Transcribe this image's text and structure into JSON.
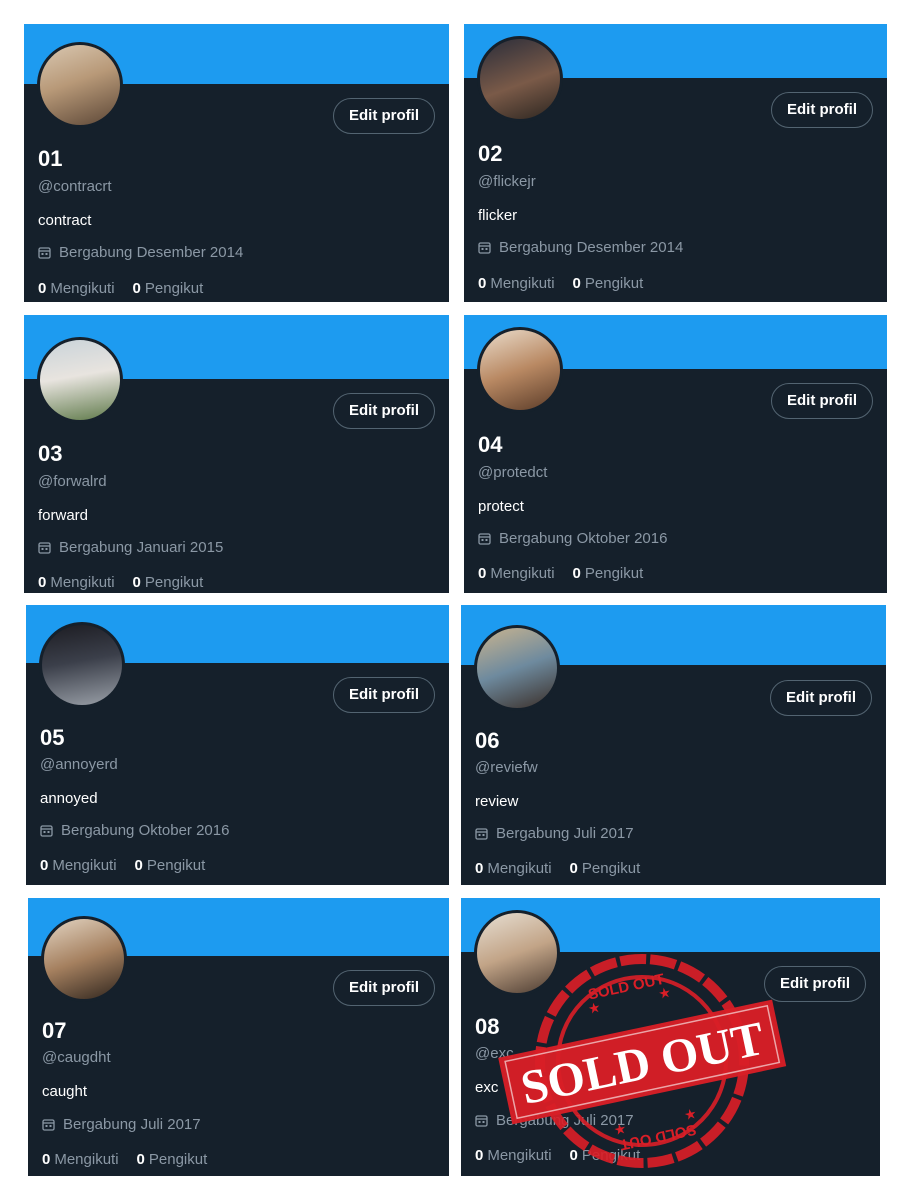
{
  "edit_label": "Edit profil",
  "following_label": "Mengikuti",
  "followers_label": "Pengikut",
  "colors": {
    "banner": "#1d9bf0",
    "card_bg": "#15202b",
    "muted_text": "#8b98a5",
    "stamp_red": "#d91e27"
  },
  "profiles": [
    {
      "number": "01",
      "handle": "@contracrt",
      "bio": "contract",
      "joined": "Bergabung Desember 2014",
      "following": "0",
      "followers": "0"
    },
    {
      "number": "02",
      "handle": "@flickejr",
      "bio": "flicker",
      "joined": "Bergabung Desember 2014",
      "following": "0",
      "followers": "0"
    },
    {
      "number": "03",
      "handle": "@forwalrd",
      "bio": "forward",
      "joined": "Bergabung Januari 2015",
      "following": "0",
      "followers": "0"
    },
    {
      "number": "04",
      "handle": "@protedct",
      "bio": "protect",
      "joined": "Bergabung Oktober 2016",
      "following": "0",
      "followers": "0"
    },
    {
      "number": "05",
      "handle": "@annoyerd",
      "bio": "annoyed",
      "joined": "Bergabung Oktober 2016",
      "following": "0",
      "followers": "0"
    },
    {
      "number": "06",
      "handle": "@reviefw",
      "bio": "review",
      "joined": "Bergabung Juli 2017",
      "following": "0",
      "followers": "0"
    },
    {
      "number": "07",
      "handle": "@caugdht",
      "bio": "caught",
      "joined": "Bergabung Juli 2017",
      "following": "0",
      "followers": "0"
    },
    {
      "number": "08",
      "handle": "@exc",
      "bio": "exc",
      "joined": "Bergabung Juli 2017",
      "following": "0",
      "followers": "0"
    }
  ],
  "stamp": {
    "main_text": "SOLD OUT",
    "ring_text": "SOLD OUT"
  }
}
